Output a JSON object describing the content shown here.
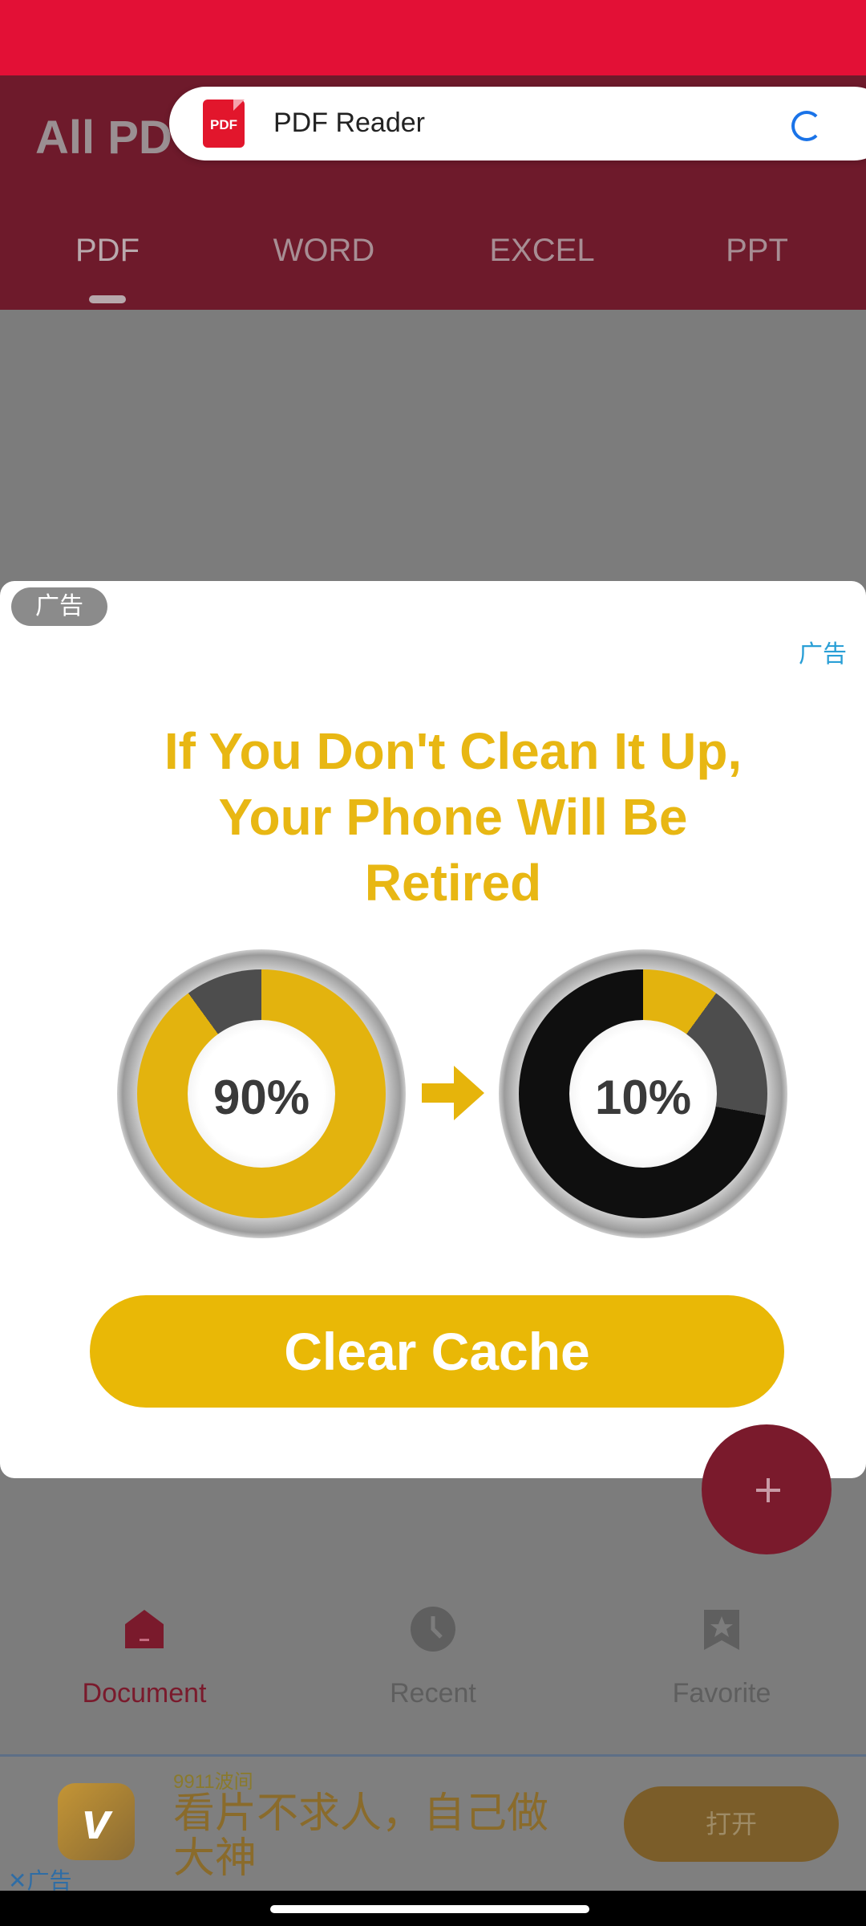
{
  "app": {
    "title": "All PD",
    "tabs": [
      "PDF",
      "WORD",
      "EXCEL",
      "PPT"
    ],
    "active_tab": "PDF"
  },
  "toast": {
    "icon_label": "PDF",
    "title": "PDF Reader"
  },
  "ad_popup": {
    "badge": "广告",
    "link": "广告",
    "headline_lines": [
      "If You Don't Clean It Up,",
      "Your Phone Will Be",
      "Retired"
    ],
    "dial_left": "90%",
    "dial_right": "10%",
    "button": "Clear Cache"
  },
  "bottom_nav": {
    "items": [
      "Document",
      "Recent",
      "Favorite"
    ],
    "active": "Document"
  },
  "banner_ad": {
    "brand": "9911波间",
    "text": "看片不求人，自己做大神",
    "button": "打开",
    "close_label": "广告",
    "icon_glyph": "v"
  },
  "colors": {
    "status_bar": "#e31036",
    "header": "#6e1a2b",
    "accent": "#e9b806"
  }
}
